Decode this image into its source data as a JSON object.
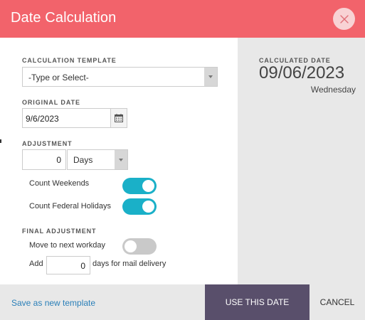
{
  "header": {
    "title": "Date Calculation",
    "close_icon": "close-icon"
  },
  "template": {
    "label": "CALCULATION TEMPLATE",
    "value": "-Type or Select-"
  },
  "original_date": {
    "label": "ORIGINAL DATE",
    "value": "9/6/2023",
    "calendar_icon": "calendar-icon"
  },
  "adjustment": {
    "label": "ADJUSTMENT",
    "amount": "0",
    "unit": "Days",
    "count_weekends_label": "Count Weekends",
    "count_weekends_on": true,
    "count_holidays_label": "Count Federal Holidays",
    "count_holidays_on": true
  },
  "final_adjustment": {
    "label": "FINAL ADJUSTMENT",
    "next_workday_label": "Move to next workday",
    "next_workday_on": false,
    "add_label": "Add",
    "mail_days": "0",
    "mail_suffix": "days for mail delivery"
  },
  "result": {
    "label": "CALCULATED DATE",
    "date": "09/06/2023",
    "weekday": "Wednesday"
  },
  "footer": {
    "save_template": "Save as new template",
    "use_date": "USE THIS DATE",
    "cancel": "CANCEL"
  },
  "colors": {
    "header": "#f2636b",
    "toggle_on": "#1ab0c8",
    "toggle_off": "#c9c9c9",
    "primary_button": "#594f6b",
    "link": "#2a7fb8"
  }
}
